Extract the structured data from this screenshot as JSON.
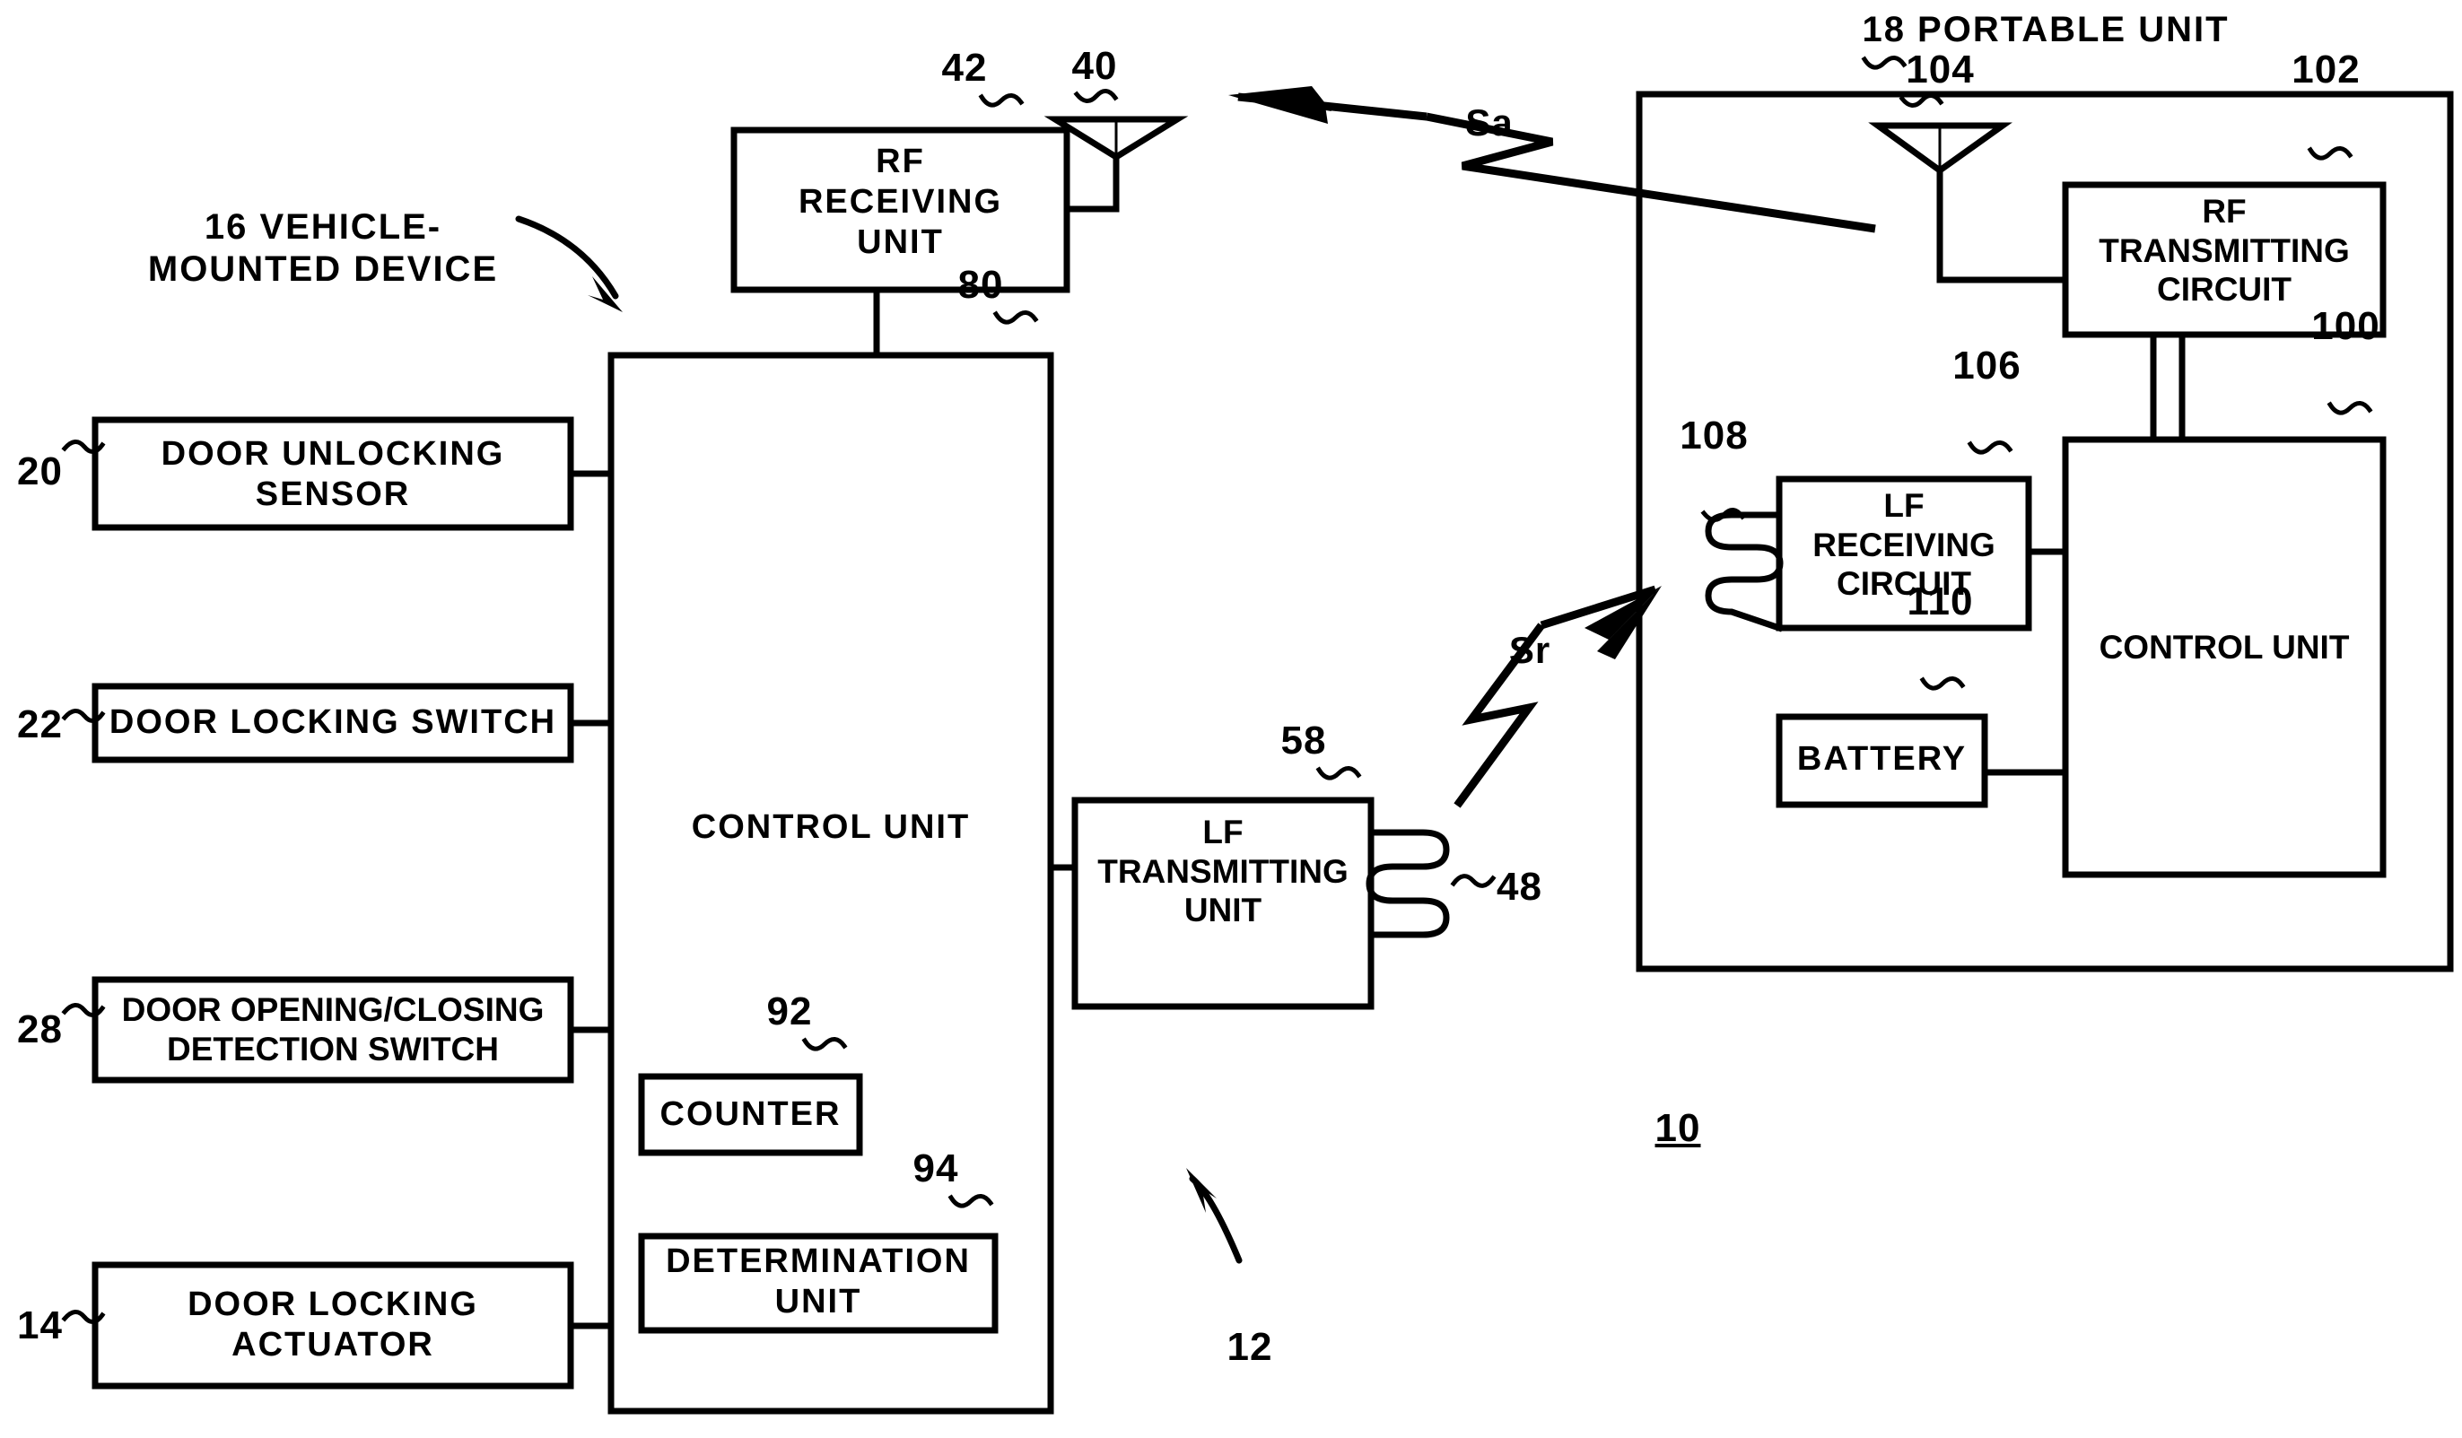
{
  "figure": {
    "figure_number": "10",
    "system_ref": "12"
  },
  "captions": {
    "vehicle_device": "16 VEHICLE-\nMOUNTED DEVICE",
    "portable_unit": "18 PORTABLE UNIT"
  },
  "signals": {
    "rf_signal": "Sa",
    "lf_signal": "Sr"
  },
  "vehicle_side": {
    "inputs": [
      {
        "ref": "20",
        "label": "DOOR UNLOCKING\nSENSOR"
      },
      {
        "ref": "22",
        "label": "DOOR LOCKING SWITCH"
      },
      {
        "ref": "28",
        "label": "DOOR OPENING/CLOSING\nDETECTION SWITCH"
      },
      {
        "ref": "14",
        "label": "DOOR LOCKING\nACTUATOR"
      }
    ],
    "rf_receiving_unit": {
      "ref": "42",
      "label": "RF\nRECEIVING\nUNIT"
    },
    "rf_antenna": {
      "ref": "40",
      "label": ""
    },
    "control_unit": {
      "ref": "80",
      "label": "CONTROL UNIT"
    },
    "counter": {
      "ref": "92",
      "label": "COUNTER"
    },
    "determination_unit": {
      "ref": "94",
      "label": "DETERMINATION\nUNIT"
    },
    "lf_transmitting_unit": {
      "ref": "58",
      "label": "LF\nTRANSMITTING\nUNIT"
    },
    "lf_transmit_coil": {
      "ref": "48",
      "label": ""
    }
  },
  "portable_side": {
    "rf_antenna": {
      "ref": "104",
      "label": ""
    },
    "rf_transmitting_circuit": {
      "ref": "102",
      "label": "RF\nTRANSMITTING\nCIRCUIT"
    },
    "control_unit": {
      "ref": "100",
      "label": "CONTROL UNIT"
    },
    "lf_receiving_circuit": {
      "ref": "106",
      "label": "LF\nRECEIVING\nCIRCUIT"
    },
    "lf_receive_coil": {
      "ref": "108",
      "label": ""
    },
    "battery": {
      "ref": "110",
      "label": "BATTERY"
    }
  },
  "colors": {
    "stroke": "#000000",
    "background": "#ffffff"
  }
}
